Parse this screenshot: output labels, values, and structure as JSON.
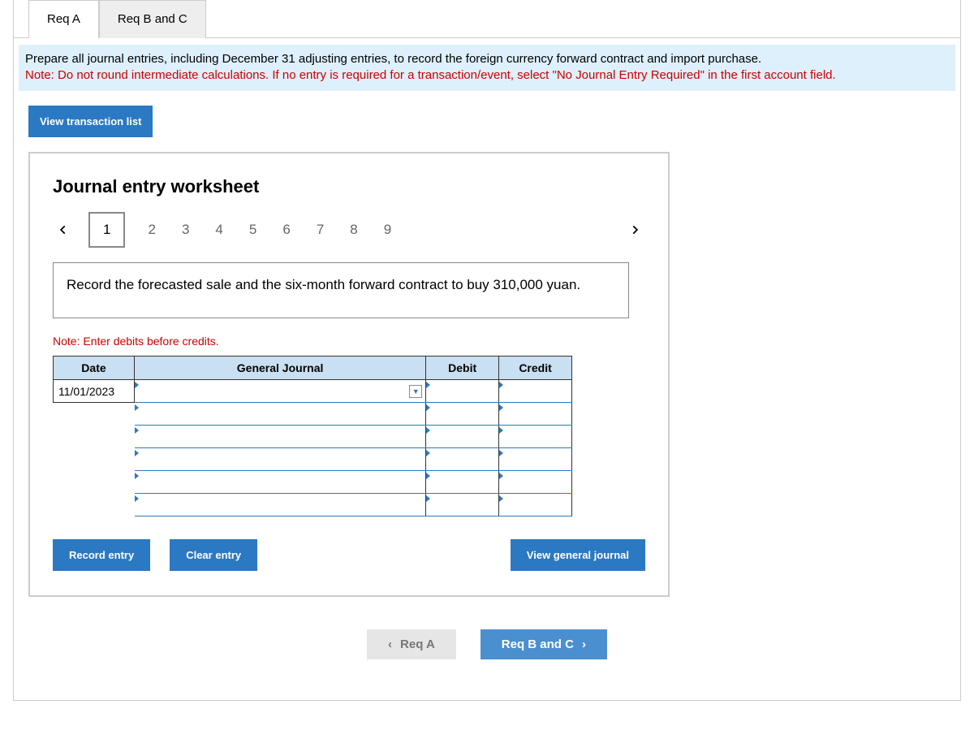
{
  "top_tabs": {
    "a": "Req A",
    "bc": "Req B and C",
    "active": "a"
  },
  "instructions": {
    "line1": "Prepare all journal entries, including December 31 adjusting entries, to record the foreign currency forward contract and import purchase.",
    "note_label": "Note:",
    "note_text": " Do not round intermediate calculations. If no entry is required for a transaction/event, select \"No Journal Entry Required\" in the first account field."
  },
  "view_transaction_btn": "View transaction list",
  "worksheet_title": "Journal entry worksheet",
  "steps": [
    "1",
    "2",
    "3",
    "4",
    "5",
    "6",
    "7",
    "8",
    "9"
  ],
  "active_step": "1",
  "prompt": "Record the forecasted sale and the six-month forward contract to buy 310,000 yuan.",
  "table_note": "Note: Enter debits before credits.",
  "table": {
    "headers": {
      "date": "Date",
      "gj": "General Journal",
      "debit": "Debit",
      "credit": "Credit"
    },
    "rows": [
      {
        "date": "11/01/2023",
        "gj": "",
        "debit": "",
        "credit": ""
      },
      {
        "date": "",
        "gj": "",
        "debit": "",
        "credit": ""
      },
      {
        "date": "",
        "gj": "",
        "debit": "",
        "credit": ""
      },
      {
        "date": "",
        "gj": "",
        "debit": "",
        "credit": ""
      },
      {
        "date": "",
        "gj": "",
        "debit": "",
        "credit": ""
      },
      {
        "date": "",
        "gj": "",
        "debit": "",
        "credit": ""
      }
    ]
  },
  "buttons": {
    "record": "Record entry",
    "clear": "Clear entry",
    "view_gj": "View general journal"
  },
  "nav": {
    "prev": "Req A",
    "next": "Req B and C"
  }
}
